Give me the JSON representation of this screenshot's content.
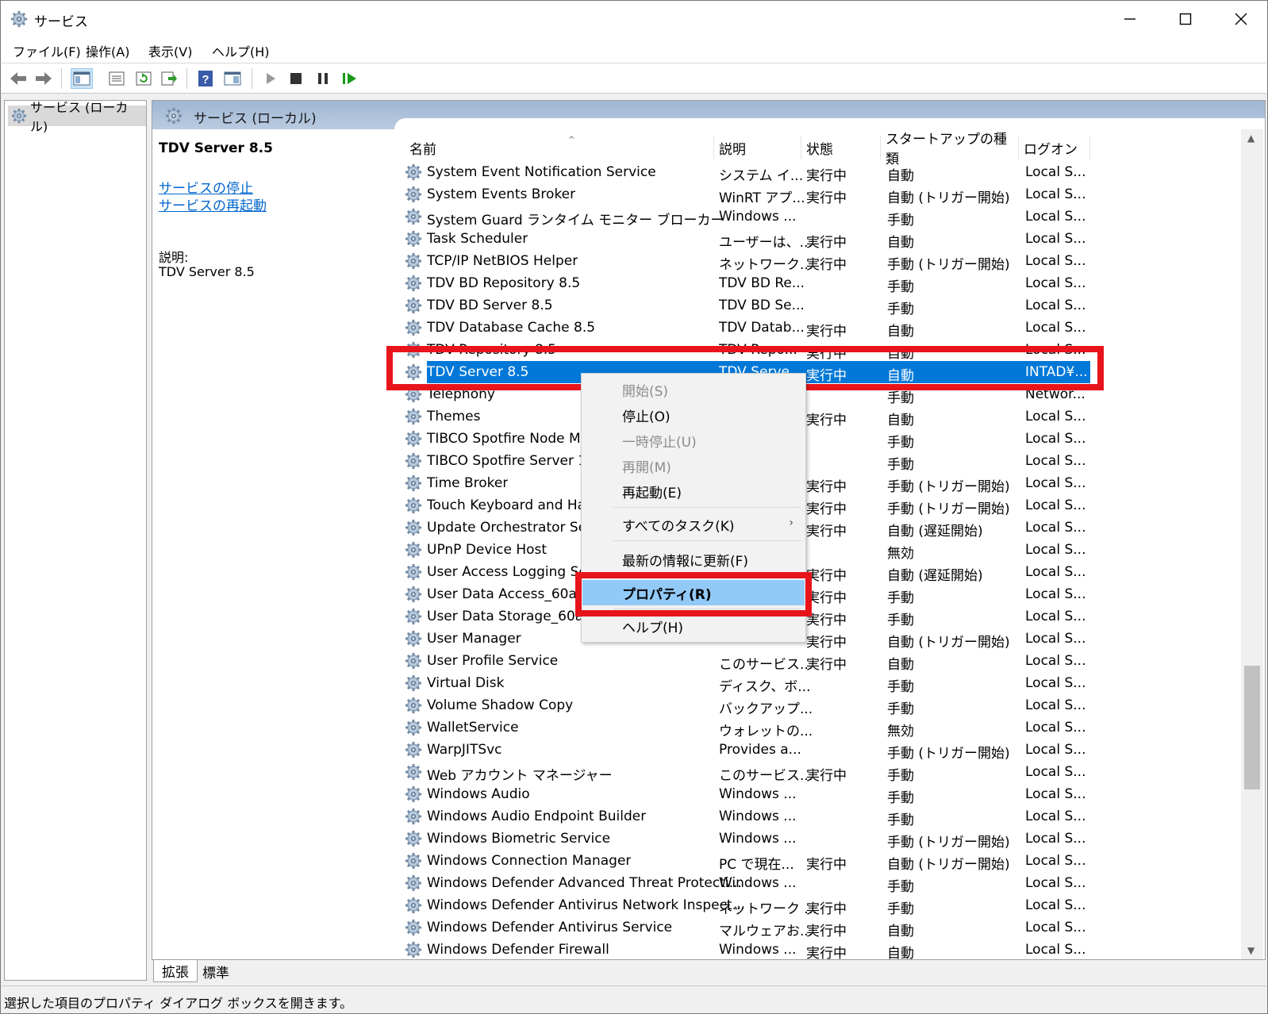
{
  "window": {
    "title": "サービス",
    "controls": [
      "minimize-icon",
      "maximize-icon",
      "close-icon"
    ]
  },
  "menu": [
    "ファイル(F)",
    "操作(A)",
    "表示(V)",
    "ヘルプ(H)"
  ],
  "toolbar": {
    "icons": [
      "back-icon",
      "forward-icon",
      "show-tree-icon",
      "properties-icon",
      "refresh-icon",
      "export-icon",
      "help-icon",
      "view-icon",
      "start-icon",
      "stop-icon",
      "pause-icon",
      "restart-icon"
    ]
  },
  "tree": {
    "item": "サービス (ローカル)"
  },
  "panel": {
    "header": "サービス (ローカル)"
  },
  "extended": {
    "title": "TDV Server 8.5",
    "link_stop": "サービスの停止",
    "link_restart": "サービスの再起動",
    "desc_label": "説明:",
    "desc_value": "TDV Server 8.5"
  },
  "columns": [
    "名前",
    "説明",
    "状態",
    "スタートアップの種類",
    "ログオン"
  ],
  "rows": [
    {
      "name": "System Event Notification Service",
      "desc": "システム イ...",
      "status": "実行中",
      "startup": "自動",
      "logon": "Local S..."
    },
    {
      "name": "System Events Broker",
      "desc": "WinRT アプ...",
      "status": "実行中",
      "startup": "自動 (トリガー開始)",
      "logon": "Local S..."
    },
    {
      "name": "System Guard ランタイム モニター ブローカー",
      "desc": "Windows ...",
      "status": "",
      "startup": "手動",
      "logon": "Local S..."
    },
    {
      "name": "Task Scheduler",
      "desc": "ユーザーは、...",
      "status": "実行中",
      "startup": "自動",
      "logon": "Local S..."
    },
    {
      "name": "TCP/IP NetBIOS Helper",
      "desc": "ネットワーク...",
      "status": "実行中",
      "startup": "手動 (トリガー開始)",
      "logon": "Local S..."
    },
    {
      "name": "TDV BD Repository 8.5",
      "desc": "TDV BD Re...",
      "status": "",
      "startup": "手動",
      "logon": "Local S..."
    },
    {
      "name": "TDV BD Server 8.5",
      "desc": "TDV BD Se...",
      "status": "",
      "startup": "手動",
      "logon": "Local S..."
    },
    {
      "name": "TDV Database Cache 8.5",
      "desc": "TDV Datab...",
      "status": "実行中",
      "startup": "自動",
      "logon": "Local S..."
    },
    {
      "name": "TDV Repository 8.5",
      "desc": "TDV Repo...",
      "status": "実行中",
      "startup": "自動",
      "logon": "Local S..."
    },
    {
      "name": "TDV Server 8.5",
      "desc": "TDV Serve...",
      "status": "実行中",
      "startup": "自動",
      "logon": "INTAD¥..."
    },
    {
      "name": "Telephony",
      "desc": "",
      "status": "",
      "startup": "手動",
      "logon": "Networ..."
    },
    {
      "name": "Themes",
      "desc": "",
      "status": "実行中",
      "startup": "自動",
      "logon": "Local S..."
    },
    {
      "name": "TIBCO Spotfire Node Man",
      "desc": "",
      "status": "",
      "startup": "手動",
      "logon": "Local S..."
    },
    {
      "name": "TIBCO Spotfire Server 11.4",
      "desc": "",
      "status": "",
      "startup": "手動",
      "logon": "Local S..."
    },
    {
      "name": "Time Broker",
      "desc": "",
      "status": "実行中",
      "startup": "手動 (トリガー開始)",
      "logon": "Local S..."
    },
    {
      "name": "Touch Keyboard and Hand",
      "desc": "",
      "status": "実行中",
      "startup": "手動 (トリガー開始)",
      "logon": "Local S..."
    },
    {
      "name": "Update Orchestrator Servi",
      "desc": "",
      "status": "実行中",
      "startup": "自動 (遅延開始)",
      "logon": "Local S..."
    },
    {
      "name": "UPnP Device Host",
      "desc": "",
      "status": "",
      "startup": "無効",
      "logon": "Local S..."
    },
    {
      "name": "User Access Logging Servi",
      "desc": "",
      "status": "実行中",
      "startup": "自動 (遅延開始)",
      "logon": "Local S..."
    },
    {
      "name": "User Data Access_60ac0",
      "desc": "",
      "status": "実行中",
      "startup": "手動",
      "logon": "Local S..."
    },
    {
      "name": "User Data Storage_60ac0",
      "desc": "",
      "status": "実行中",
      "startup": "手動",
      "logon": "Local S..."
    },
    {
      "name": "User Manager",
      "desc": "",
      "status": "実行中",
      "startup": "自動 (トリガー開始)",
      "logon": "Local S..."
    },
    {
      "name": "User Profile Service",
      "desc": "このサービス...",
      "status": "実行中",
      "startup": "自動",
      "logon": "Local S..."
    },
    {
      "name": "Virtual Disk",
      "desc": "ディスク、ボ...",
      "status": "",
      "startup": "手動",
      "logon": "Local S..."
    },
    {
      "name": "Volume Shadow Copy",
      "desc": "バックアップ...",
      "status": "",
      "startup": "手動",
      "logon": "Local S..."
    },
    {
      "name": "WalletService",
      "desc": "ウォレットの...",
      "status": "",
      "startup": "無効",
      "logon": "Local S..."
    },
    {
      "name": "WarpJITSvc",
      "desc": "Provides a...",
      "status": "",
      "startup": "手動 (トリガー開始)",
      "logon": "Local S..."
    },
    {
      "name": "Web アカウント マネージャー",
      "desc": "このサービス...",
      "status": "実行中",
      "startup": "手動",
      "logon": "Local S..."
    },
    {
      "name": "Windows Audio",
      "desc": "Windows ...",
      "status": "",
      "startup": "手動",
      "logon": "Local S..."
    },
    {
      "name": "Windows Audio Endpoint Builder",
      "desc": "Windows ...",
      "status": "",
      "startup": "手動",
      "logon": "Local S..."
    },
    {
      "name": "Windows Biometric Service",
      "desc": "Windows ...",
      "status": "",
      "startup": "手動 (トリガー開始)",
      "logon": "Local S..."
    },
    {
      "name": "Windows Connection Manager",
      "desc": "PC で現在...",
      "status": "実行中",
      "startup": "自動 (トリガー開始)",
      "logon": "Local S..."
    },
    {
      "name": "Windows Defender Advanced Threat Protecti...",
      "desc": "Windows ...",
      "status": "",
      "startup": "手動",
      "logon": "Local S..."
    },
    {
      "name": "Windows Defender Antivirus Network Inspect...",
      "desc": "ネットワーク ...",
      "status": "実行中",
      "startup": "手動",
      "logon": "Local S..."
    },
    {
      "name": "Windows Defender Antivirus Service",
      "desc": "マルウェアお...",
      "status": "実行中",
      "startup": "自動",
      "logon": "Local S..."
    },
    {
      "name": "Windows Defender Firewall",
      "desc": "Windows ...",
      "status": "実行中",
      "startup": "自動",
      "logon": "Local S..."
    }
  ],
  "context_menu": {
    "start": "開始(S)",
    "stop": "停止(O)",
    "pause": "一時停止(U)",
    "resume": "再開(M)",
    "restart": "再起動(E)",
    "all_tasks": "すべてのタスク(K)",
    "refresh": "最新の情報に更新(F)",
    "properties": "プロパティ(R)",
    "help": "ヘルプ(H)"
  },
  "tabs": [
    "拡張",
    "標準"
  ],
  "status_bar": "選択した項目のプロパティ ダイアログ ボックスを開きます。",
  "colors": {
    "selection": "#0078d7",
    "highlight_menu": "#91c9f7",
    "annotation_red": "#e8141c",
    "link": "#0066cc"
  }
}
